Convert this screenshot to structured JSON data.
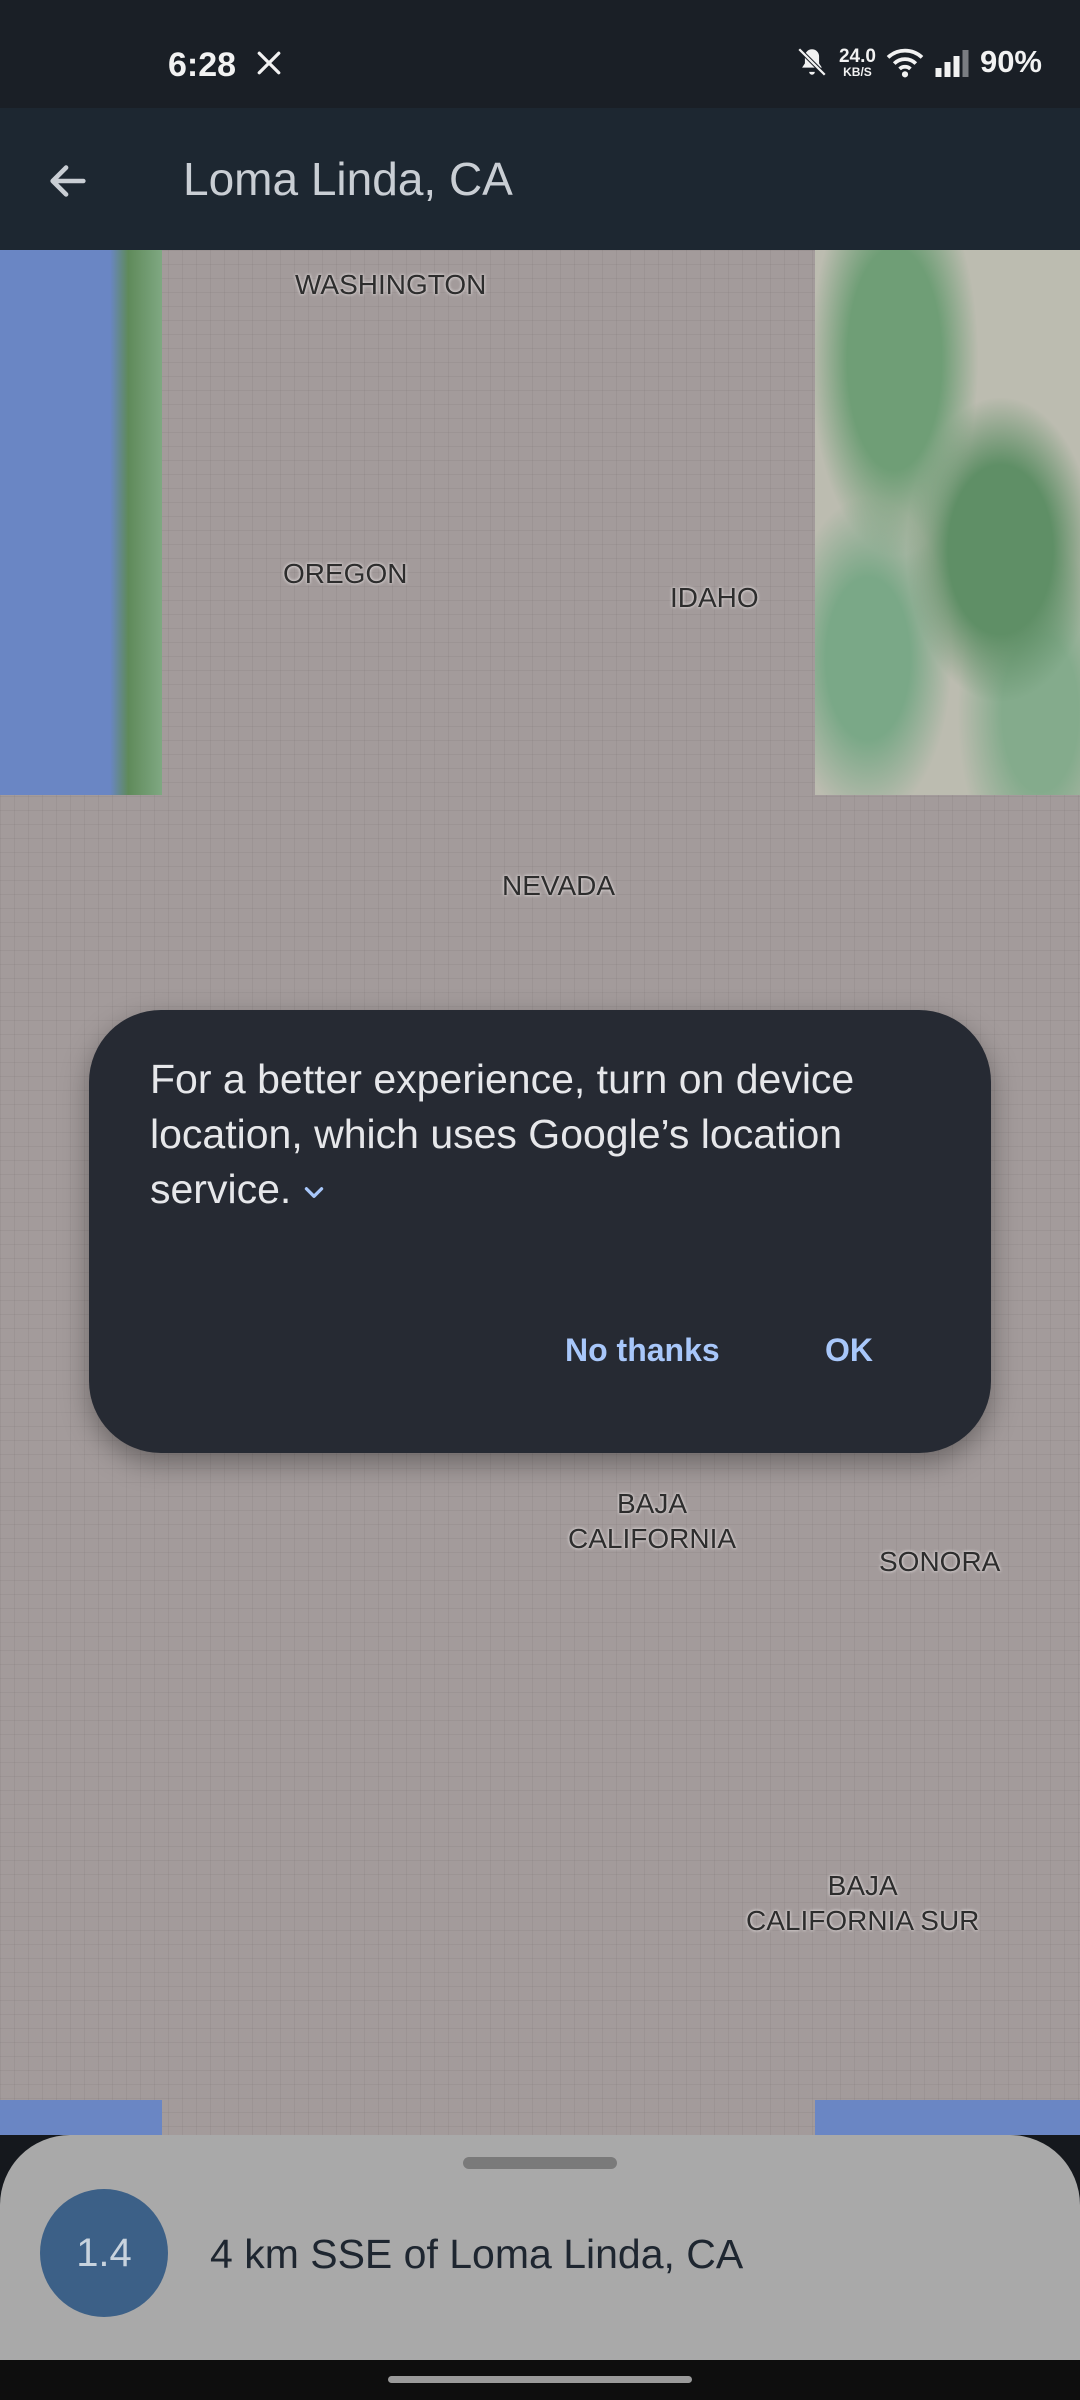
{
  "status_bar": {
    "time": "6:28",
    "net_speed_value": "24.0",
    "net_speed_unit": "KB/S",
    "battery": "90%",
    "icons": [
      "x-logo-icon",
      "bell-off-icon",
      "wifi-icon",
      "signal-icon"
    ]
  },
  "app_bar": {
    "title": "Loma Linda, CA",
    "back_icon": "arrow-left-icon"
  },
  "map": {
    "labels": {
      "washington": "WASHINGTON",
      "oregon": "OREGON",
      "idaho": "IDAHO",
      "nevada": "NEVADA",
      "baja_california": "BAJA\nCALIFORNIA",
      "sonora": "SONORA",
      "baja_california_sur": "BAJA\nCALIFORNIA SUR"
    }
  },
  "dialog": {
    "message": "For a better experience, turn on device location, which uses Google’s location service.",
    "expand_icon": "chevron-down-icon",
    "no_thanks_label": "No thanks",
    "ok_label": "OK",
    "accent_color": "#a8c7fa"
  },
  "bottom_sheet": {
    "magnitude": "1.4",
    "title": "4 km SSE of Loma Linda, CA",
    "badge_color": "#3c6087"
  }
}
